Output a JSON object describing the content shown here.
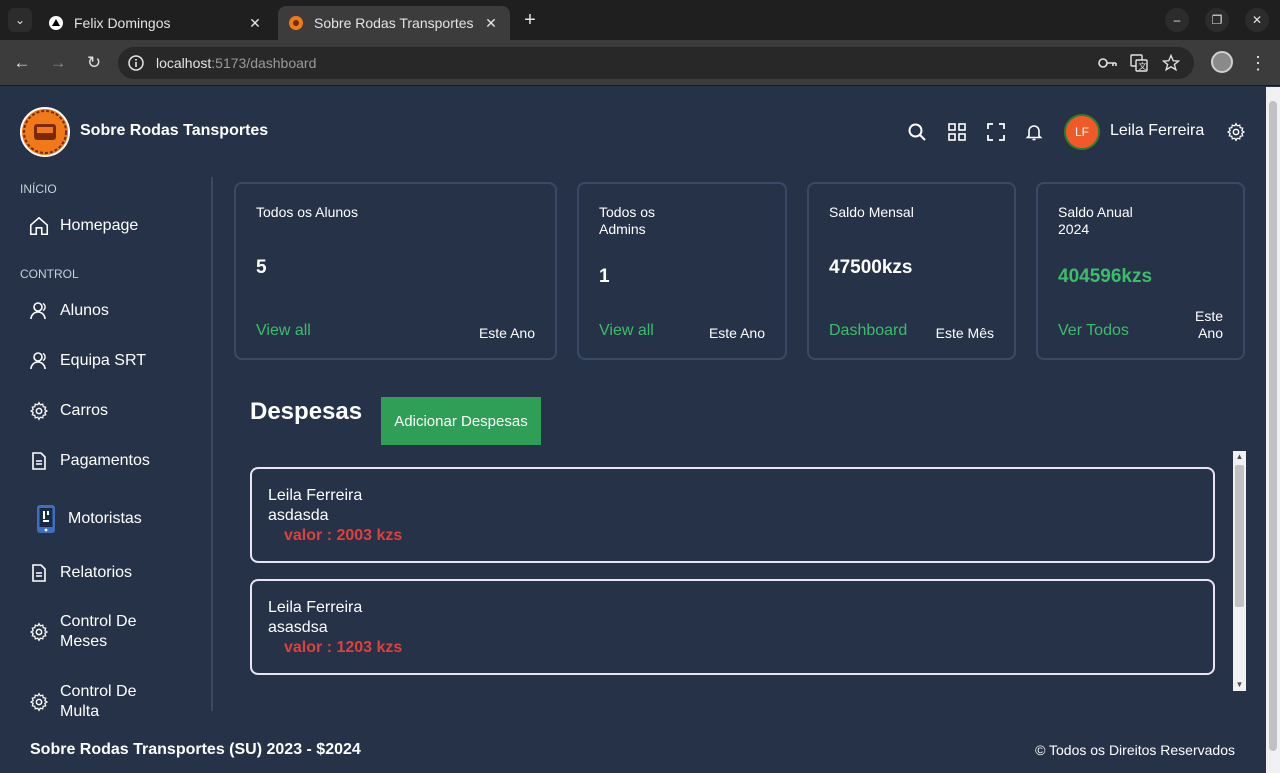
{
  "browser": {
    "tabs": [
      {
        "title": "Felix Domingos",
        "active": false
      },
      {
        "title": "Sobre Rodas Transportes",
        "active": true
      }
    ],
    "url_host": "localhost",
    "url_path": ":5173/dashboard"
  },
  "header": {
    "brand": "Sobre Rodas Tansportes",
    "avatar_initials": "LF",
    "username": "Leila Ferreira"
  },
  "sidebar": {
    "section_inicio": "INÍCIO",
    "section_control": "CONTROL",
    "items": [
      {
        "label": "Homepage",
        "icon": "home-icon"
      },
      {
        "label": "Alunos",
        "icon": "user-icon"
      },
      {
        "label": "Equipa SRT",
        "icon": "user-icon"
      },
      {
        "label": "Carros",
        "icon": "gear-icon"
      },
      {
        "label": "Pagamentos",
        "icon": "document-icon"
      },
      {
        "label": "Motoristas",
        "icon": "phone-icon"
      },
      {
        "label": "Relatorios",
        "icon": "document-icon"
      },
      {
        "label": "Control De\nMeses",
        "icon": "gear-icon"
      },
      {
        "label": "Control De\nMulta",
        "icon": "gear-icon"
      }
    ]
  },
  "cards": [
    {
      "label": "Todos os Alunos",
      "value": "5",
      "link": "View all",
      "period": "Este Ano",
      "value_color": "#ffffff"
    },
    {
      "label": "Todos os\nAdmins",
      "value": "1",
      "link": "View all",
      "period": "Este Ano",
      "value_color": "#ffffff"
    },
    {
      "label": "Saldo Mensal",
      "value": "47500kzs",
      "link": "Dashboard",
      "period": "Este Mês",
      "value_color": "#ffffff"
    },
    {
      "label": "Saldo Anual\n2024",
      "value": "404596kzs",
      "link": "Ver Todos",
      "period": "Este\nAno",
      "value_color": "#3cbd6a"
    }
  ],
  "despesas": {
    "title": "Despesas",
    "add_button": "Adicionar Despesas",
    "items": [
      {
        "name": "Leila Ferreira",
        "description": "asdasda",
        "value": "valor : 2003 kzs"
      },
      {
        "name": "Leila Ferreira",
        "description": "asasdsa",
        "value": "valor : 1203 kzs"
      }
    ]
  },
  "footer": {
    "left": "Sobre Rodas Transportes (SU) 2023 - $2024",
    "right": "© Todos os Direitos Reservados"
  },
  "colors": {
    "background": "#263248",
    "accent_green": "#3cbd6a",
    "button_green": "#2f9e57",
    "expense_red": "#e0403a",
    "avatar": "#f05a28"
  }
}
